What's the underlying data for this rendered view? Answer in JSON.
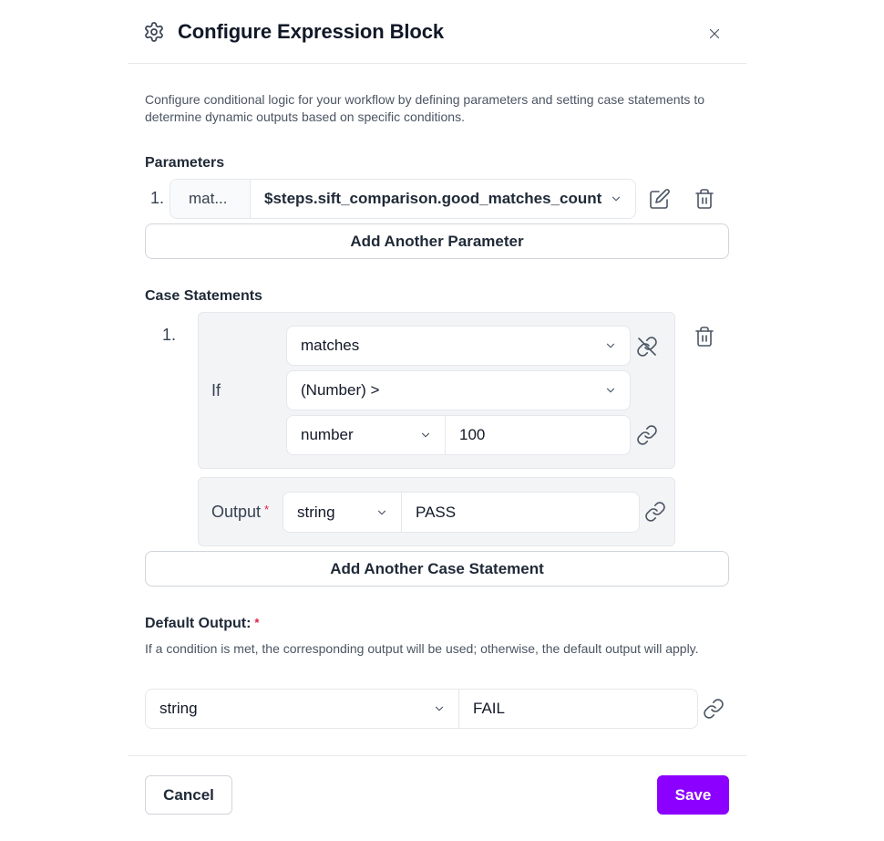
{
  "dialog": {
    "title": "Configure Expression Block",
    "description": "Configure conditional logic for your workflow by defining parameters and setting case statements to determine dynamic outputs based on specific conditions."
  },
  "parameters": {
    "label": "Parameters",
    "items": [
      {
        "index": "1.",
        "name": "mat...",
        "value": "$steps.sift_comparison.good_matches_count"
      }
    ],
    "add_label": "Add Another Parameter"
  },
  "cases": {
    "label": "Case Statements",
    "items": [
      {
        "index": "1.",
        "if_label": "If",
        "left_operand": "matches",
        "operator": "(Number) >",
        "right_type": "number",
        "right_value": "100",
        "output_label": "Output",
        "output_required": "*",
        "output_type": "string",
        "output_value": "PASS"
      }
    ],
    "add_label": "Add Another Case Statement"
  },
  "default_output": {
    "label": "Default Output:",
    "required": "*",
    "hint": "If a condition is met, the corresponding output will be used; otherwise, the default output will apply.",
    "type": "string",
    "value": "FAIL"
  },
  "footer": {
    "cancel_label": "Cancel",
    "save_label": "Save"
  },
  "colors": {
    "accent": "#8b00ff",
    "required": "#e11d48",
    "panel": "#f3f4f6"
  },
  "icons": [
    "gear-icon",
    "close-icon",
    "edit-icon",
    "trash-icon",
    "chevron-down-icon",
    "link-icon",
    "unlink-icon"
  ]
}
